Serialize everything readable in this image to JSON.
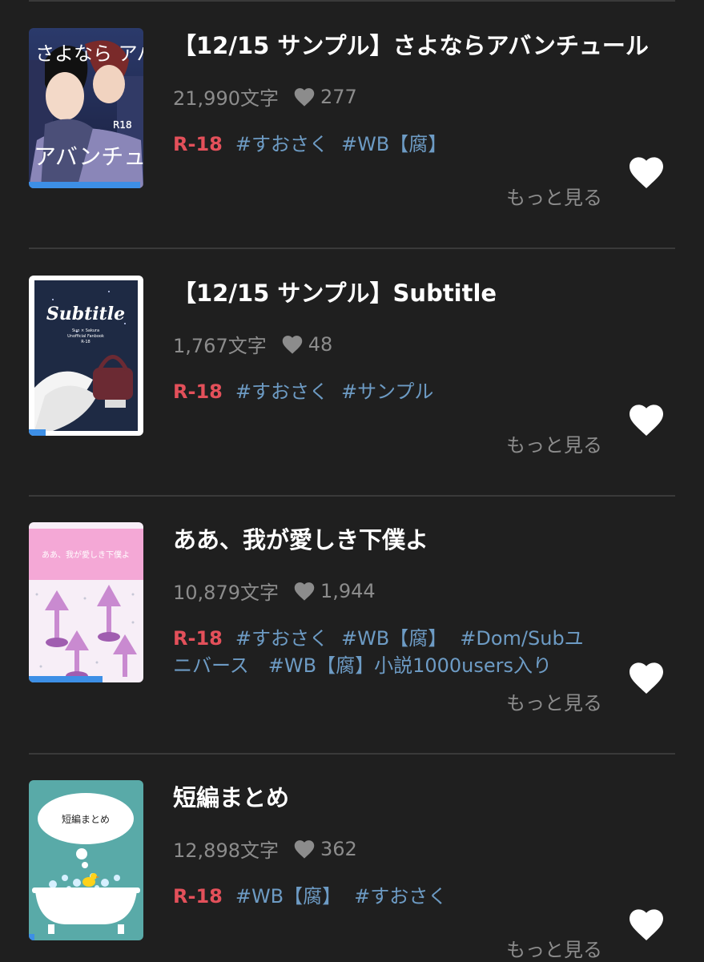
{
  "works": [
    {
      "title": "【12/15 サンプル】さよならアバンチュール",
      "char_count": "21,990文字",
      "likes": "277",
      "rating": "R-18",
      "tags": [
        "#すおさく",
        "#WB【腐】"
      ],
      "tags_line2": "",
      "more_label": "もっと見る",
      "cover_text": "さよなら アバンチュール",
      "cover_badge": "R18",
      "progress": 0.97
    },
    {
      "title": "【12/15 サンプル】Subtitle",
      "char_count": "1,767文字",
      "likes": "48",
      "rating": "R-18",
      "tags": [
        "#すおさく",
        "#サンプル"
      ],
      "tags_line2": "",
      "more_label": "もっと見る",
      "cover_text": "Subtitle",
      "cover_subtext": "Suo × Sakura",
      "cover_subtext2": "Unofficial Fanbook",
      "cover_badge": "R-18",
      "progress": 0.15
    },
    {
      "title": "ああ、我が愛しき下僕よ",
      "char_count": "10,879文字",
      "likes": "1,944",
      "rating": "R-18",
      "tags": [
        "#すおさく",
        "#WB【腐】",
        "#Dom/Subユ"
      ],
      "tags_line2": "ニバース　#WB【腐】小説1000users入り",
      "more_label": "もっと見る",
      "cover_text": "ああ、我が愛しき下僕よ",
      "progress": 0.64
    },
    {
      "title": "短編まとめ",
      "char_count": "12,898文字",
      "likes": "362",
      "rating": "R-18",
      "tags": [
        "#WB【腐】",
        "#すおさく"
      ],
      "tags_line2": "",
      "more_label": "もっと見る",
      "cover_text": "短編まとめ",
      "progress": 0.05
    }
  ],
  "colors": {
    "background": "#1f1f1f",
    "rating": "#e3505a",
    "tag": "#6d9bc4",
    "meta": "#8c8c8c",
    "progress": "#3d8fe6"
  }
}
